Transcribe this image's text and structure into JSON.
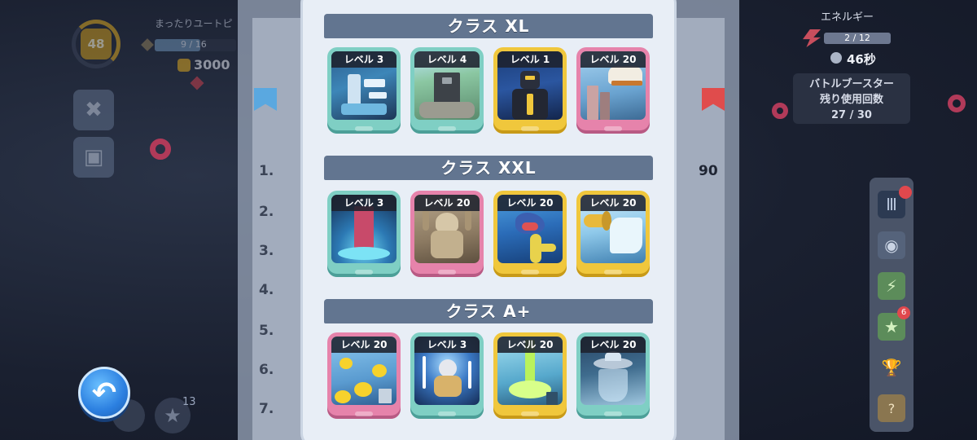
{
  "player": {
    "level": "48",
    "name": "まったりユートピ",
    "xp": "9 / 16",
    "coins": "3000"
  },
  "background_board": {
    "ranks": [
      "1.",
      "2.",
      "3.",
      "4.",
      "5.",
      "6.",
      "7."
    ],
    "partial_score": "90"
  },
  "energy": {
    "label": "エネルギー",
    "value": "2 / 12",
    "timer": "46秒"
  },
  "booster": {
    "title": "バトルブースター",
    "subtitle": "残り使用回数",
    "count": "27 / 30"
  },
  "right_toolbar": {
    "badge_count": "6"
  },
  "star_count": "13",
  "modal": {
    "sections": [
      {
        "title": "クラス XL",
        "cards": [
          {
            "label": "レベル 3",
            "frame": "teal",
            "art": "skeleton-hand"
          },
          {
            "label": "レベル 4",
            "frame": "teal",
            "art": "stone-block"
          },
          {
            "label": "レベル 1",
            "frame": "gold",
            "art": "dark-knight"
          },
          {
            "label": "レベル 20",
            "frame": "pink",
            "art": "giant-foot"
          }
        ]
      },
      {
        "title": "クラス XXL",
        "cards": [
          {
            "label": "レベル 3",
            "frame": "teal",
            "art": "vortex-tower"
          },
          {
            "label": "レベル 20",
            "frame": "pink",
            "art": "cthulhu-statue"
          },
          {
            "label": "レベル 20",
            "frame": "gold",
            "art": "sea-serpent"
          },
          {
            "label": "レベル 20",
            "frame": "gold",
            "art": "pipe-flood"
          }
        ]
      },
      {
        "title": "クラス A+",
        "cards": [
          {
            "label": "レベル 20",
            "frame": "pink",
            "art": "rubber-ducks"
          },
          {
            "label": "レベル 3",
            "frame": "teal",
            "art": "lightning-god"
          },
          {
            "label": "レベル 20",
            "frame": "gold",
            "art": "green-beam"
          },
          {
            "label": "レベル 20",
            "frame": "teal",
            "art": "ufo"
          }
        ]
      }
    ]
  }
}
